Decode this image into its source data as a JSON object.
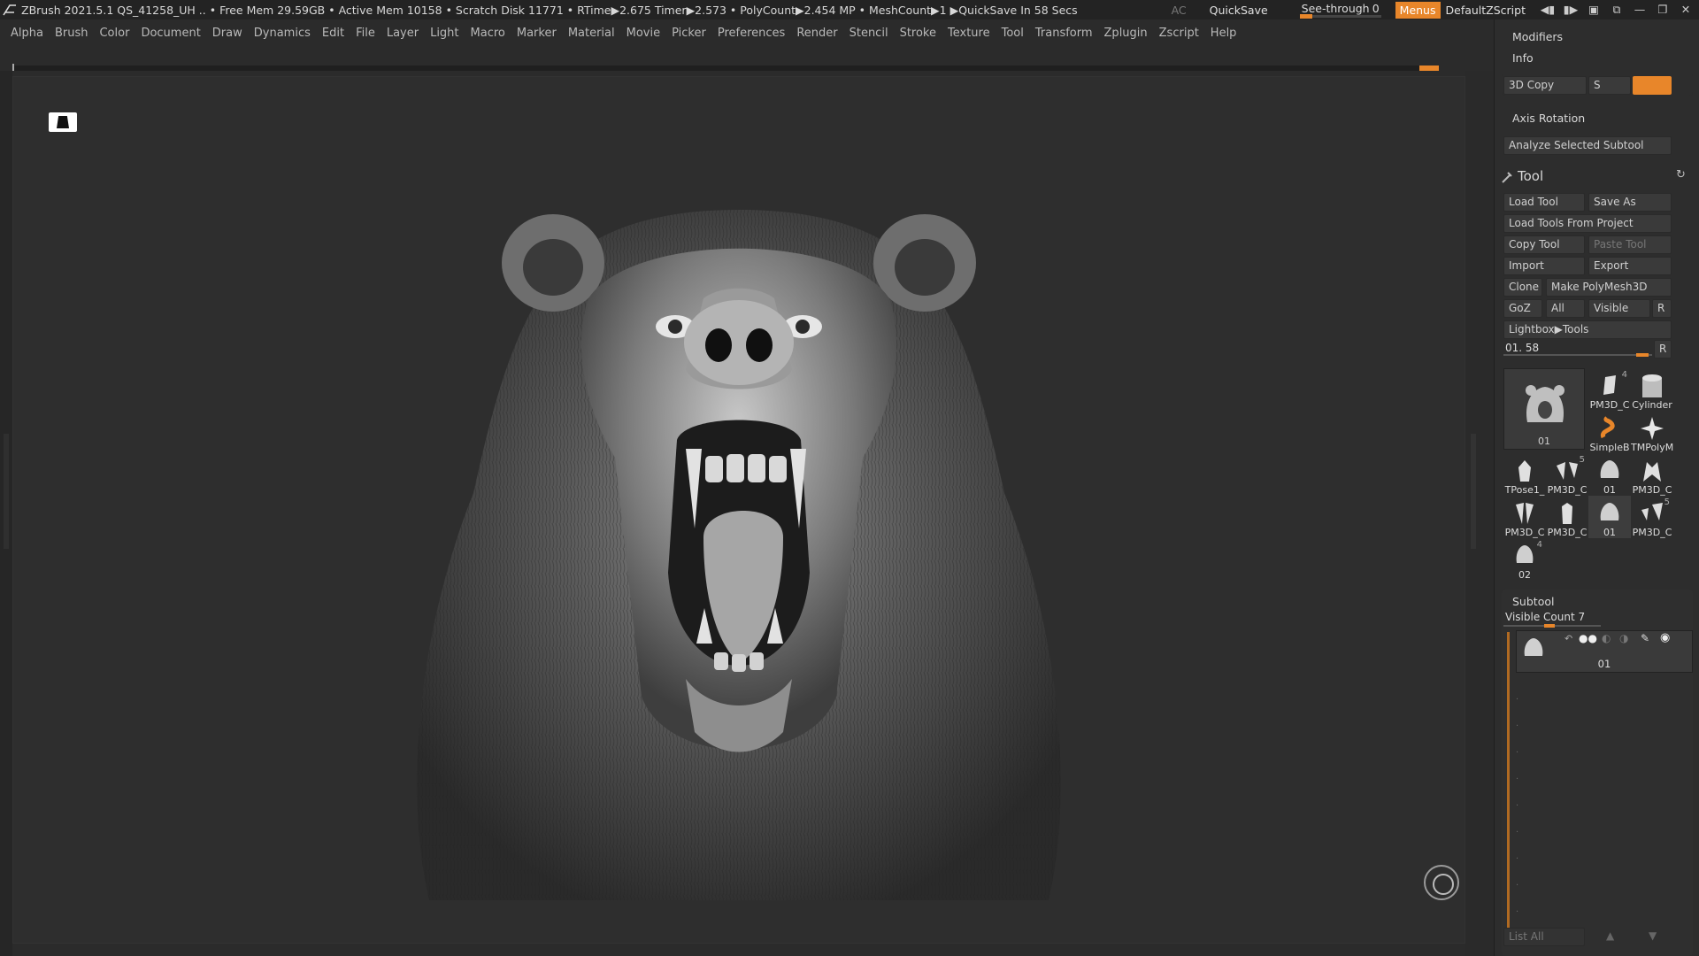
{
  "titlebar": {
    "text": "ZBrush 2021.5.1    QS_41258_UH    .. • Free Mem 29.59GB • Active Mem 10158 • Scratch Disk 11771 •  RTime▶2.675 Timer▶2.573 • PolyCount▶2.454 MP  • MeshCount▶1  ▶QuickSave In 58 Secs",
    "ac": "AC",
    "quicksave": "QuickSave",
    "see_through_label": "See-through",
    "see_through_value": "0",
    "menus": "Menus",
    "default_zscript": "DefaultZScript"
  },
  "menubar": {
    "items": [
      "Alpha",
      "Brush",
      "Color",
      "Document",
      "Draw",
      "Dynamics",
      "Edit",
      "File",
      "Layer",
      "Light",
      "Macro",
      "Marker",
      "Material",
      "Movie",
      "Picker",
      "Preferences",
      "Render",
      "Stencil",
      "Stroke",
      "Texture",
      "Tool",
      "Transform",
      "Zplugin",
      "Zscript",
      "Help"
    ]
  },
  "rightpanel": {
    "modifiers": "Modifiers",
    "info": "Info",
    "copy3d": "3D Copy",
    "s_label": "S",
    "axis_rotation": "Axis Rotation",
    "analyze": "Analyze Selected Subtool",
    "tool_title": "Tool",
    "buttons": {
      "load_tool": "Load Tool",
      "save_as": "Save As",
      "load_from_project": "Load Tools From Project",
      "copy_tool": "Copy Tool",
      "paste_tool": "Paste Tool",
      "import": "Import",
      "export": "Export",
      "clone": "Clone",
      "make_polymesh": "Make PolyMesh3D",
      "goz": "GoZ",
      "all": "All",
      "visible": "Visible",
      "r": "R",
      "lightbox_tools": "Lightbox▶Tools"
    },
    "tool_slider_label": "01. 58",
    "tool_slider_r": "R",
    "current_tool": "01",
    "thumbs": [
      {
        "label": "PM3D_C",
        "num": "4"
      },
      {
        "label": "Cylinder",
        "num": ""
      },
      {
        "label": "SimpleB",
        "num": ""
      },
      {
        "label": "TMPolyM",
        "num": ""
      },
      {
        "label": "TPose1_",
        "num": ""
      },
      {
        "label": "PM3D_C",
        "num": "5"
      },
      {
        "label": "01",
        "num": ""
      },
      {
        "label": "PM3D_C",
        "num": ""
      },
      {
        "label": "PM3D_C",
        "num": ""
      },
      {
        "label": "PM3D_C",
        "num": ""
      },
      {
        "label": "01",
        "num": ""
      },
      {
        "label": "PM3D_C",
        "num": "5"
      },
      {
        "label": "02",
        "num": "4"
      }
    ],
    "subtool_title": "Subtool",
    "visible_count": "Visible Count 7",
    "subtool_name": "01",
    "list_all": "List All"
  }
}
